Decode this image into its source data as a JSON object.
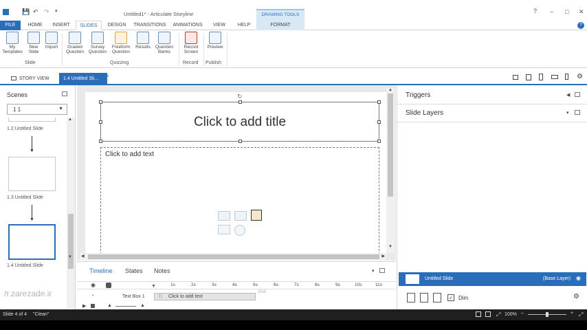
{
  "window": {
    "title": "Untitled1* - Articulate Storyline",
    "contextual_group": "DRAWING TOOLS"
  },
  "tabs": [
    "FILE",
    "HOME",
    "INSERT",
    "SLIDES",
    "DESIGN",
    "TRANSITIONS",
    "ANIMATIONS",
    "VIEW",
    "HELP",
    "FORMAT"
  ],
  "ribbon": {
    "buttons": [
      {
        "label1": "My",
        "label2": "Templates"
      },
      {
        "label1": "New",
        "label2": "Slide"
      },
      {
        "label1": "Import",
        "label2": ""
      },
      {
        "label1": "Graded",
        "label2": "Question"
      },
      {
        "label1": "Survey",
        "label2": "Question"
      },
      {
        "label1": "Freeform",
        "label2": "Question"
      },
      {
        "label1": "Results",
        "label2": ""
      },
      {
        "label1": "Question",
        "label2": "Banks"
      },
      {
        "label1": "Record",
        "label2": "Screen"
      },
      {
        "label1": "Preview",
        "label2": ""
      }
    ],
    "groups": [
      "Slide",
      "Quizzing",
      "Record",
      "Publish"
    ]
  },
  "doc_tabs": {
    "story_view": "STORY VIEW",
    "active": "1.4 Untitled Sli..."
  },
  "scenes": {
    "title": "Scenes",
    "selector": "1 1",
    "slides": [
      "1.2 Untitled Slide",
      "1.3 Untitled Slide",
      "1.4 Untitled Slide"
    ]
  },
  "slide": {
    "title_placeholder": "Click to add title",
    "text_placeholder": "Click to add text"
  },
  "timeline": {
    "tabs": [
      "Timeline",
      "States",
      "Notes"
    ],
    "ticks": [
      "1s",
      "2s",
      "3s",
      "4s",
      "5s",
      "6s",
      "7s",
      "8s",
      "9s",
      "10s",
      "11s"
    ],
    "row_name": "Text Box 1",
    "row_text": "Click to add text",
    "end_label": "End"
  },
  "right": {
    "triggers": "Triggers",
    "slide_layers": "Slide Layers",
    "base_layer_name": "Untitled Slide",
    "base_layer_tag": "(Base Layer)",
    "dim_label": "Dim"
  },
  "status": {
    "slide_count": "Slide 4 of 4",
    "theme": "\"Clean\"",
    "zoom": "100%"
  },
  "watermark": "/r.zarezade.ir",
  "colors": {
    "accent": "#2a6ebb",
    "format_band": "#d9e8f5"
  }
}
